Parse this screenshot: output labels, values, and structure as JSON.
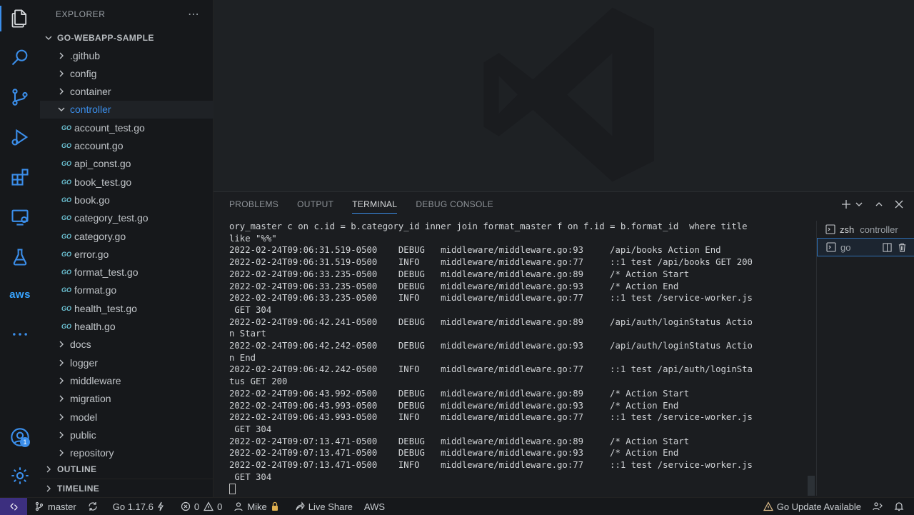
{
  "sidebar": {
    "title": "EXPLORER",
    "project": "GO-WEBAPP-SAMPLE",
    "items": [
      {
        "label": ".github",
        "type": "folder"
      },
      {
        "label": "config",
        "type": "folder"
      },
      {
        "label": "container",
        "type": "folder"
      },
      {
        "label": "controller",
        "type": "folder-open"
      },
      {
        "label": "account_test.go",
        "type": "file"
      },
      {
        "label": "account.go",
        "type": "file"
      },
      {
        "label": "api_const.go",
        "type": "file"
      },
      {
        "label": "book_test.go",
        "type": "file"
      },
      {
        "label": "book.go",
        "type": "file"
      },
      {
        "label": "category_test.go",
        "type": "file"
      },
      {
        "label": "category.go",
        "type": "file"
      },
      {
        "label": "error.go",
        "type": "file"
      },
      {
        "label": "format_test.go",
        "type": "file"
      },
      {
        "label": "format.go",
        "type": "file"
      },
      {
        "label": "health_test.go",
        "type": "file"
      },
      {
        "label": "health.go",
        "type": "file"
      },
      {
        "label": "docs",
        "type": "folder"
      },
      {
        "label": "logger",
        "type": "folder"
      },
      {
        "label": "middleware",
        "type": "folder"
      },
      {
        "label": "migration",
        "type": "folder"
      },
      {
        "label": "model",
        "type": "folder"
      },
      {
        "label": "public",
        "type": "folder"
      },
      {
        "label": "repository",
        "type": "folder"
      }
    ],
    "file_icon_text": "GO",
    "outline": "OUTLINE",
    "timeline": "TIMELINE"
  },
  "activity": {
    "aws_label": "aws",
    "account_badge": "1"
  },
  "panel": {
    "tabs": [
      "PROBLEMS",
      "OUTPUT",
      "TERMINAL",
      "DEBUG CONSOLE"
    ],
    "active_tab": "TERMINAL",
    "terminal_lines": [
      "ory_master c on c.id = b.category_id inner join format_master f on f.id = b.format_id  where title",
      "like \"%%\"",
      "2022-02-24T09:06:31.519-0500    DEBUG   middleware/middleware.go:93     /api/books Action End",
      "2022-02-24T09:06:31.519-0500    INFO    middleware/middleware.go:77     ::1 test /api/books GET 200",
      "2022-02-24T09:06:33.235-0500    DEBUG   middleware/middleware.go:89     /* Action Start",
      "2022-02-24T09:06:33.235-0500    DEBUG   middleware/middleware.go:93     /* Action End",
      "2022-02-24T09:06:33.235-0500    INFO    middleware/middleware.go:77     ::1 test /service-worker.js",
      " GET 304",
      "2022-02-24T09:06:42.241-0500    DEBUG   middleware/middleware.go:89     /api/auth/loginStatus Actio",
      "n Start",
      "2022-02-24T09:06:42.242-0500    DEBUG   middleware/middleware.go:93     /api/auth/loginStatus Actio",
      "n End",
      "2022-02-24T09:06:42.242-0500    INFO    middleware/middleware.go:77     ::1 test /api/auth/loginSta",
      "tus GET 200",
      "2022-02-24T09:06:43.992-0500    DEBUG   middleware/middleware.go:89     /* Action Start",
      "2022-02-24T09:06:43.993-0500    DEBUG   middleware/middleware.go:93     /* Action End",
      "2022-02-24T09:06:43.993-0500    INFO    middleware/middleware.go:77     ::1 test /service-worker.js",
      " GET 304",
      "2022-02-24T09:07:13.471-0500    DEBUG   middleware/middleware.go:89     /* Action Start",
      "2022-02-24T09:07:13.471-0500    DEBUG   middleware/middleware.go:93     /* Action End",
      "2022-02-24T09:07:13.471-0500    INFO    middleware/middleware.go:77     ::1 test /service-worker.js",
      " GET 304"
    ],
    "terminals": [
      {
        "name": "zsh",
        "detail": "controller"
      },
      {
        "name": "go",
        "detail": ""
      }
    ]
  },
  "status": {
    "branch": "master",
    "go_version": "Go 1.17.6",
    "errors": "0",
    "warnings": "0",
    "user": "Mike",
    "live_share": "Live Share",
    "aws": "AWS",
    "update": "Go Update Available"
  },
  "colors": {
    "accent": "#3b8eea",
    "folder_selected": "#3b8eea",
    "remote_bg": "#3c2f7f",
    "update_warning": "#e2c08d"
  }
}
